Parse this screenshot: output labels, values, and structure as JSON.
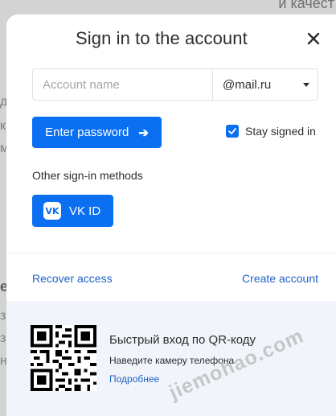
{
  "background": {
    "top_text": "и качест",
    "lines": [
      "д",
      "к",
      "м",
      "е.",
      "з",
      "з",
      "н"
    ]
  },
  "modal": {
    "title": "Sign in to the account",
    "account_placeholder": "Account name",
    "domain": "@mail.ru",
    "enter_password": "Enter password",
    "stay_signed_in": "Stay signed in",
    "stay_signed_in_checked": true,
    "other_methods": "Other sign-in methods",
    "vk_button": "VK ID",
    "vk_logo": "VK",
    "recover": "Recover access",
    "create": "Create account",
    "qr": {
      "title": "Быстрый вход по QR-коду",
      "subtitle": "Наведите камеру телефона",
      "more": "Подробнее"
    }
  },
  "watermark": "jiemohao.com",
  "icons": {
    "close": "close-icon",
    "arrow": "arrow-right-icon",
    "check": "checkbox-check-icon",
    "caret": "chevron-down-icon",
    "vk": "vk-logo-icon",
    "qr": "qr-code-icon"
  },
  "colors": {
    "accent": "#0b6ff2",
    "link": "#1f63c8",
    "qr_panel_bg": "#f1f4fa",
    "text": "#2c2d2e"
  }
}
